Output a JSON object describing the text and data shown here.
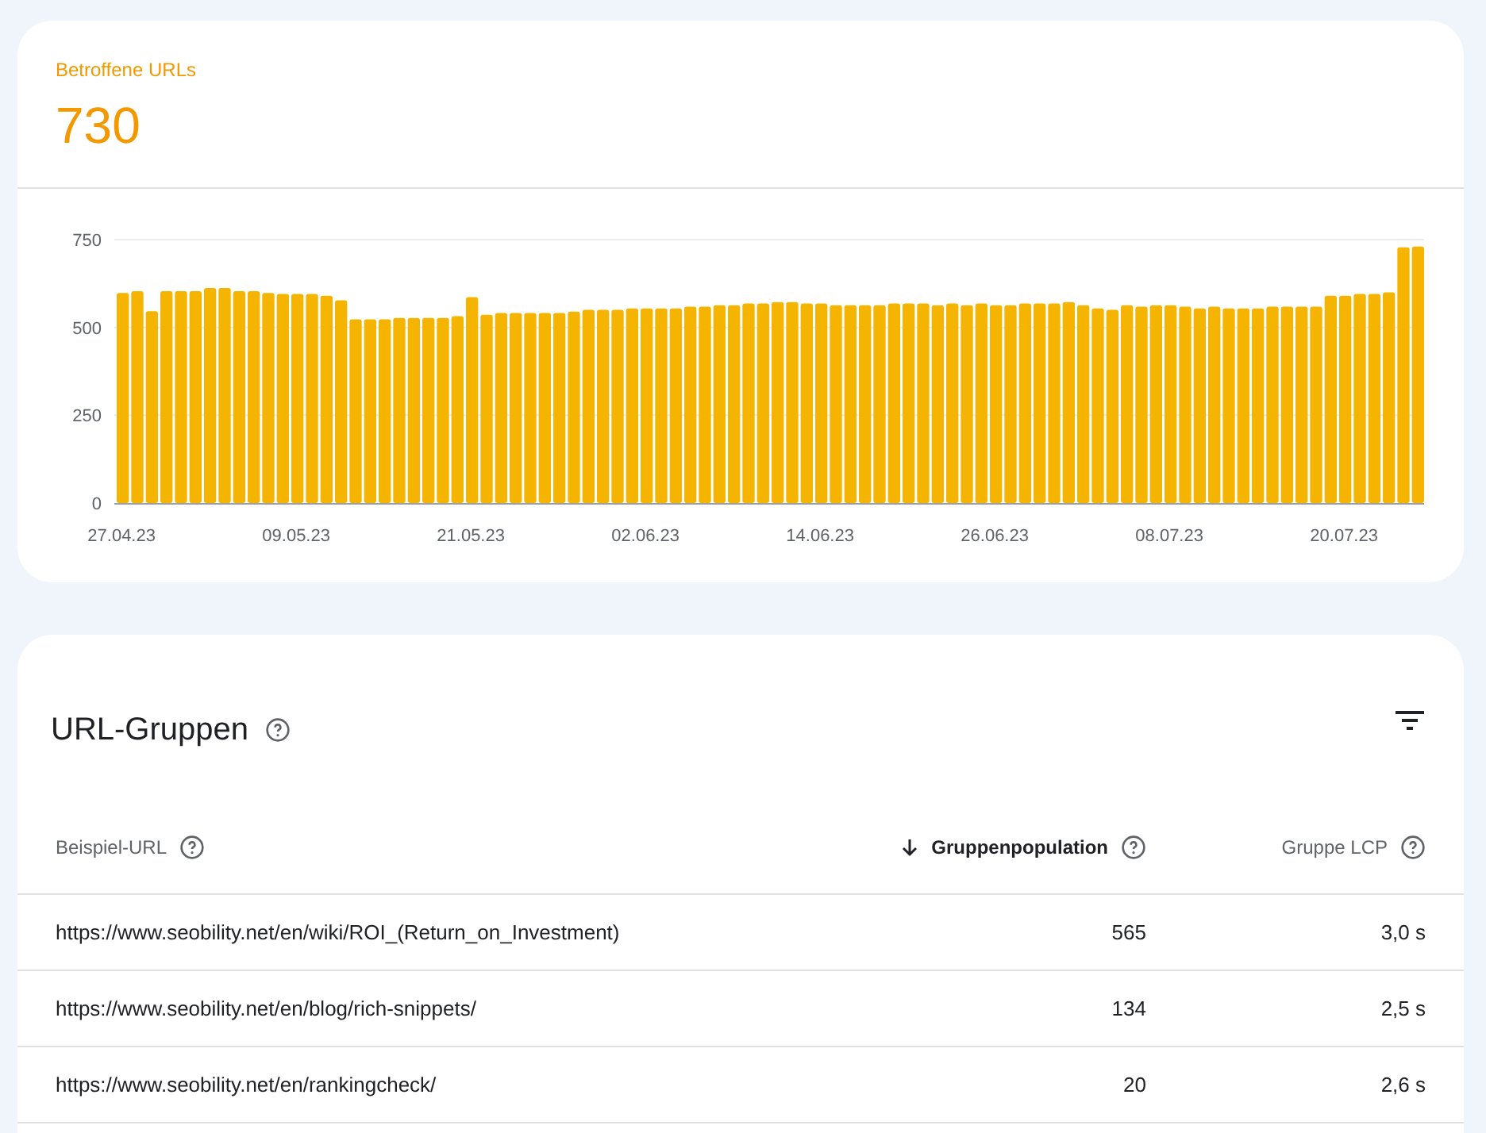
{
  "summary": {
    "label": "Betroffene URLs",
    "value": "730"
  },
  "chart": {
    "chart_data": {
      "type": "bar",
      "yticks": [
        0,
        250,
        500,
        750
      ],
      "ylim": [
        0,
        750
      ],
      "series": [
        {
          "color": "#f4b400",
          "values": [
            598,
            603,
            546,
            603,
            603,
            603,
            612,
            612,
            603,
            603,
            598,
            595,
            595,
            595,
            590,
            577,
            523,
            523,
            523,
            527,
            527,
            527,
            527,
            532,
            586,
            536,
            541,
            541,
            541,
            541,
            541,
            545,
            550,
            550,
            550,
            554,
            554,
            554,
            554,
            559,
            559,
            563,
            563,
            568,
            568,
            572,
            572,
            568,
            568,
            563,
            563,
            563,
            563,
            568,
            568,
            568,
            563,
            568,
            563,
            568,
            563,
            563,
            568,
            568,
            568,
            572,
            563,
            554,
            550,
            563,
            559,
            563,
            563,
            559,
            554,
            559,
            554,
            554,
            554,
            559,
            559,
            559,
            559,
            590,
            590,
            595,
            595,
            600,
            728,
            730
          ]
        }
      ]
    }
  },
  "date_labels": [
    "27.04.23",
    "09.05.23",
    "21.05.23",
    "02.06.23",
    "14.06.23",
    "26.06.23",
    "08.07.23",
    "20.07.23"
  ],
  "groups": {
    "title": "URL-Gruppen",
    "columns": [
      {
        "label": "Beispiel-URL",
        "sorted": false
      },
      {
        "label": "Gruppenpopulation",
        "sorted": true
      },
      {
        "label": "Gruppe LCP",
        "sorted": false
      }
    ],
    "rows": [
      {
        "url": "https://www.seobility.net/en/wiki/ROI_(Return_on_Investment)",
        "population": "565",
        "lcp": "3,0 s"
      },
      {
        "url": "https://www.seobility.net/en/blog/rich-snippets/",
        "population": "134",
        "lcp": "2,5 s"
      },
      {
        "url": "https://www.seobility.net/en/rankingcheck/",
        "population": "20",
        "lcp": "2,6 s"
      }
    ]
  }
}
